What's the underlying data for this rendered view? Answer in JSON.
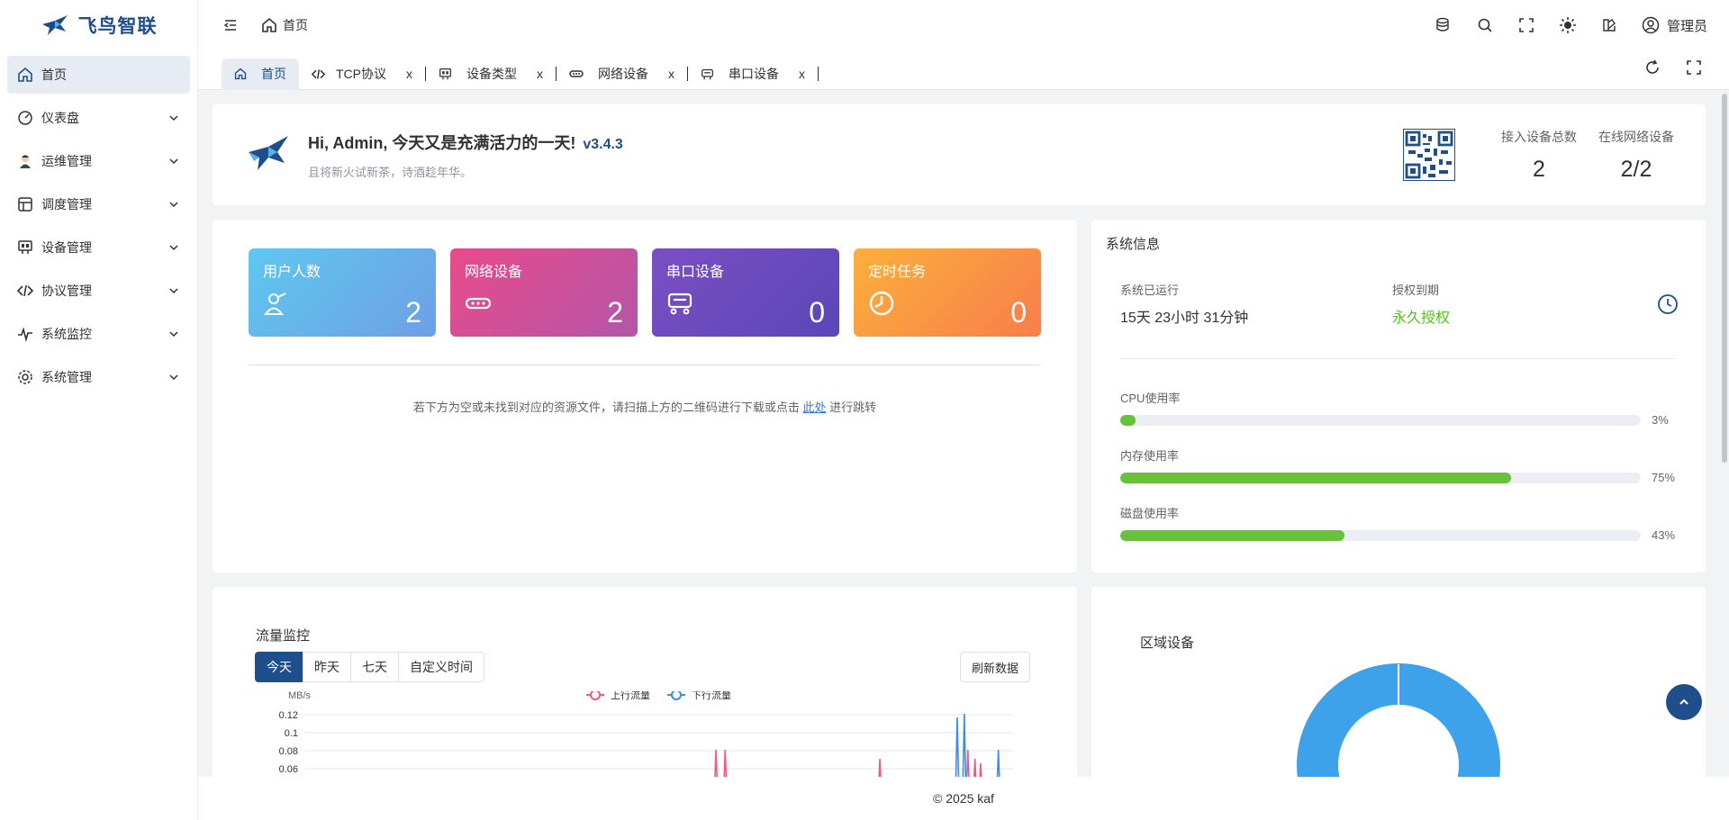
{
  "app": {
    "name": "飞鸟智联"
  },
  "sidebar": {
    "items": [
      {
        "label": "首页",
        "icon": "home-icon"
      },
      {
        "label": "仪表盘",
        "icon": "dashboard-icon"
      },
      {
        "label": "运维管理",
        "icon": "operator-icon"
      },
      {
        "label": "调度管理",
        "icon": "schedule-icon"
      },
      {
        "label": "设备管理",
        "icon": "device-icon"
      },
      {
        "label": "协议管理",
        "icon": "code-icon"
      },
      {
        "label": "系统监控",
        "icon": "pulse-icon"
      },
      {
        "label": "系统管理",
        "icon": "gear-icon"
      }
    ]
  },
  "header": {
    "breadcrumb": "首页",
    "user": "管理员"
  },
  "tabs": [
    {
      "label": "首页",
      "icon": "home-icon"
    },
    {
      "label": "TCP协议",
      "icon": "code-icon",
      "close": "x"
    },
    {
      "label": "设备类型",
      "icon": "device-icon",
      "close": "x"
    },
    {
      "label": "网络设备",
      "icon": "network-icon",
      "close": "x"
    },
    {
      "label": "串口设备",
      "icon": "serial-icon",
      "close": "x"
    }
  ],
  "welcome": {
    "greeting": "Hi, Admin, 今天又是充满活力的一天!",
    "version": "v3.4.3",
    "subtitle": "且将新火试新茶，诗酒趁年华。",
    "stats": [
      {
        "label": "接入设备总数",
        "value": "2"
      },
      {
        "label": "在线网络设备",
        "value": "2/2"
      }
    ]
  },
  "tiles": [
    {
      "label": "用户人数",
      "value": "2"
    },
    {
      "label": "网络设备",
      "value": "2"
    },
    {
      "label": "串口设备",
      "value": "0"
    },
    {
      "label": "定时任务",
      "value": "0"
    }
  ],
  "hint": {
    "before": "若下方为空或未找到对应的资源文件，请扫描上方的二维码进行下载或点击 ",
    "link": "此处",
    "after": " 进行跳转"
  },
  "system": {
    "title": "系统信息",
    "uptime_label": "系统已运行",
    "uptime_value": "15天 23小时 31分钟",
    "license_label": "授权到期",
    "license_value": "永久授权",
    "usage": [
      {
        "label": "CPU使用率",
        "percent": 3,
        "text": "3%"
      },
      {
        "label": "内存使用率",
        "percent": 75,
        "text": "75%"
      },
      {
        "label": "磁盘使用率",
        "percent": 43,
        "text": "43%"
      }
    ],
    "colors": {
      "bar": "#67c23a",
      "track": "#ebeef5"
    }
  },
  "traffic": {
    "title": "流量监控",
    "ranges": [
      "今天",
      "昨天",
      "七天",
      "自定义时间"
    ],
    "refresh": "刷新数据"
  },
  "chart_data": {
    "type": "line",
    "ylabel": "MB/s",
    "y_ticks": [
      "0.12",
      "0.1",
      "0.08",
      "0.06"
    ],
    "ylim": [
      0.06,
      0.13
    ],
    "series": [
      {
        "name": "上行流量",
        "color": "#f05a7e",
        "spikes": [
          [
            0.58,
            0.081
          ],
          [
            0.593,
            0.081
          ],
          [
            0.811,
            0.071
          ],
          [
            0.935,
            0.081
          ],
          [
            0.945,
            0.071
          ],
          [
            0.953,
            0.066
          ]
        ]
      },
      {
        "name": "下行流量",
        "color": "#3a8ee6",
        "spikes": [
          [
            0.92,
            0.117
          ],
          [
            0.93,
            0.121
          ],
          [
            0.978,
            0.081
          ]
        ]
      }
    ]
  },
  "region": {
    "title": "区域设备",
    "chart_data": {
      "type": "pie",
      "slices": [
        {
          "value": 2,
          "color": "#3ea2ea"
        }
      ]
    }
  },
  "footer": "© 2025 kaf",
  "colors": {
    "primary": "#1f4e8c",
    "active_bg": "#e6ebf4"
  }
}
